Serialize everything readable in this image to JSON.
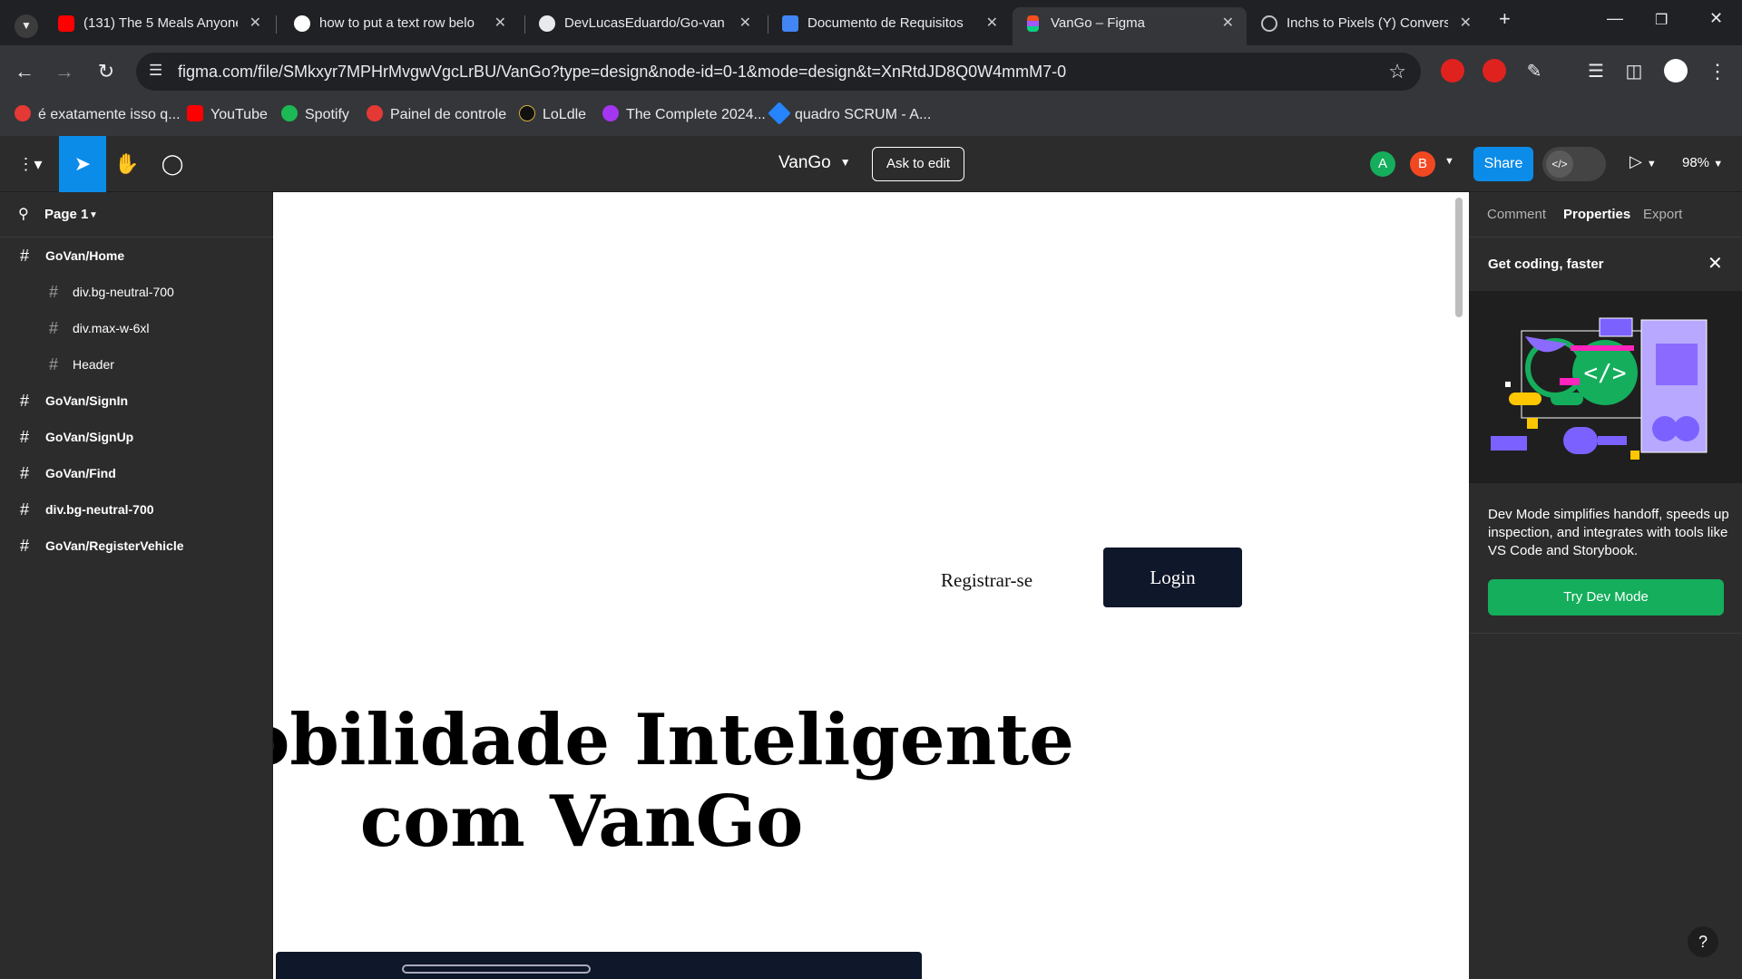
{
  "browser": {
    "tabs": [
      {
        "title": "(131) The 5 Meals Anyone",
        "icon": "youtube-icon"
      },
      {
        "title": "how to put a text row belo",
        "icon": "google-icon"
      },
      {
        "title": "DevLucasEduardo/Go-van",
        "icon": "github-icon"
      },
      {
        "title": "Documento de Requisitos",
        "icon": "docs-icon"
      },
      {
        "title": "VanGo – Figma",
        "icon": "figma-icon",
        "active": true
      },
      {
        "title": "Inchs to Pixels (Y) Conversi",
        "icon": "globe-icon"
      }
    ],
    "url": "figma.com/file/SMkxyr7MPHrMvgwVgcLrBU/VanGo?type=design&node-id=0-1&mode=design&t=XnRtdJD8Q0W4mmM7-0",
    "bookmarks": [
      {
        "label": "é exatamente isso q...",
        "color": "#e53935"
      },
      {
        "label": "YouTube",
        "color": "#ff0000"
      },
      {
        "label": "Spotify",
        "color": "#1db954"
      },
      {
        "label": "Painel de controle",
        "color": "#e53935"
      },
      {
        "label": "LoLdle",
        "color": "#2a2a2a"
      },
      {
        "label": "The Complete 2024...",
        "color": "#a435f0"
      },
      {
        "label": "quadro SCRUM - A...",
        "color": "#2684ff"
      }
    ]
  },
  "figma": {
    "file_name": "VanGo",
    "ask_to_edit": "Ask to edit",
    "avatars": [
      {
        "letter": "A",
        "color": "#14ae5c"
      },
      {
        "letter": "B",
        "color": "#f24822"
      }
    ],
    "share": "Share",
    "zoom": "98%",
    "page": "Page 1",
    "layers": [
      {
        "label": "GoVan/Home",
        "level": 0
      },
      {
        "label": "div.bg-neutral-700",
        "level": 1
      },
      {
        "label": "div.max-w-6xl",
        "level": 1
      },
      {
        "label": "Header",
        "level": 1
      },
      {
        "label": "GoVan/SignIn",
        "level": 0
      },
      {
        "label": "GoVan/SignUp",
        "level": 0
      },
      {
        "label": "GoVan/Find",
        "level": 0
      },
      {
        "label": "div.bg-neutral-700",
        "level": 0
      },
      {
        "label": "GoVan/RegisterVehicle",
        "level": 0
      }
    ],
    "right_tabs": [
      "Comment",
      "Properties",
      "Export"
    ],
    "promo": {
      "title": "Get coding, faster",
      "text": "Dev Mode simplifies handoff, speeds up inspection, and integrates with tools like VS Code and Storybook.",
      "button": "Try Dev Mode"
    }
  },
  "canvas": {
    "register_link": "Registrar-se",
    "login_button": "Login",
    "hero_line1": "Mobilidade Inteligente",
    "hero_line2": "com VanGo"
  }
}
